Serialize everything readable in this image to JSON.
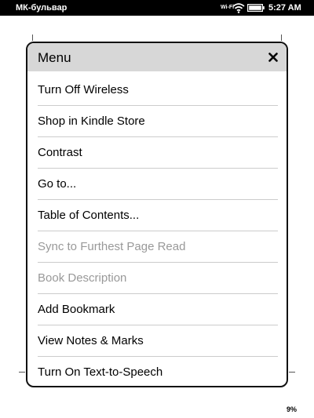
{
  "status_bar": {
    "title": "МК-бульвар",
    "wifi_label": "Wi-Fi",
    "time": "5:27 AM"
  },
  "icons": {
    "wifi": "wifi-signal-icon",
    "battery": "battery-icon",
    "close": "close-icon"
  },
  "menu": {
    "title": "Menu",
    "close_symbol": "×",
    "items": [
      {
        "label": "Turn Off Wireless",
        "enabled": true
      },
      {
        "label": "Shop in Kindle Store",
        "enabled": true
      },
      {
        "label": "Contrast",
        "enabled": true
      },
      {
        "label": "Go to...",
        "enabled": true
      },
      {
        "label": "Table of Contents...",
        "enabled": true
      },
      {
        "label": "Sync to Furthest Page Read",
        "enabled": false
      },
      {
        "label": "Book Description",
        "enabled": false
      },
      {
        "label": "Add Bookmark",
        "enabled": true
      },
      {
        "label": "View Notes & Marks",
        "enabled": true
      },
      {
        "label": "Turn On Text-to-Speech",
        "enabled": true
      }
    ]
  },
  "footer": {
    "progress": "9%"
  },
  "colors": {
    "status_bar_bg": "#000000",
    "header_bg": "#d7d7d7",
    "disabled_text": "#999999",
    "divider": "#cccccc"
  }
}
